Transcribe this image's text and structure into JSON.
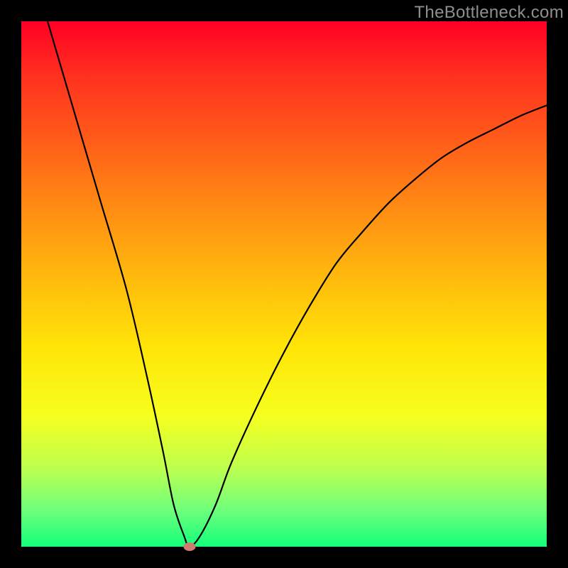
{
  "watermark": "TheBottleneck.com",
  "chart_data": {
    "type": "line",
    "title": "",
    "xlabel": "",
    "ylabel": "",
    "xlim": [
      0,
      100
    ],
    "ylim": [
      0,
      100
    ],
    "grid": false,
    "background": "rainbow-vertical-red-to-green",
    "series": [
      {
        "name": "bottleneck-curve",
        "color": "#000000",
        "x": [
          5,
          10,
          15,
          20,
          24,
          27,
          29,
          31,
          32,
          34,
          37,
          40,
          45,
          50,
          55,
          60,
          65,
          70,
          75,
          80,
          85,
          90,
          95,
          100
        ],
        "values": [
          100,
          83,
          66,
          49,
          32,
          18,
          8,
          2,
          0,
          2,
          8,
          16,
          27,
          37,
          46,
          54,
          60,
          65.5,
          70,
          74,
          77,
          79.5,
          82,
          84
        ]
      }
    ],
    "marker": {
      "x": 32,
      "y": 0,
      "color": "#cd7c6f"
    }
  }
}
